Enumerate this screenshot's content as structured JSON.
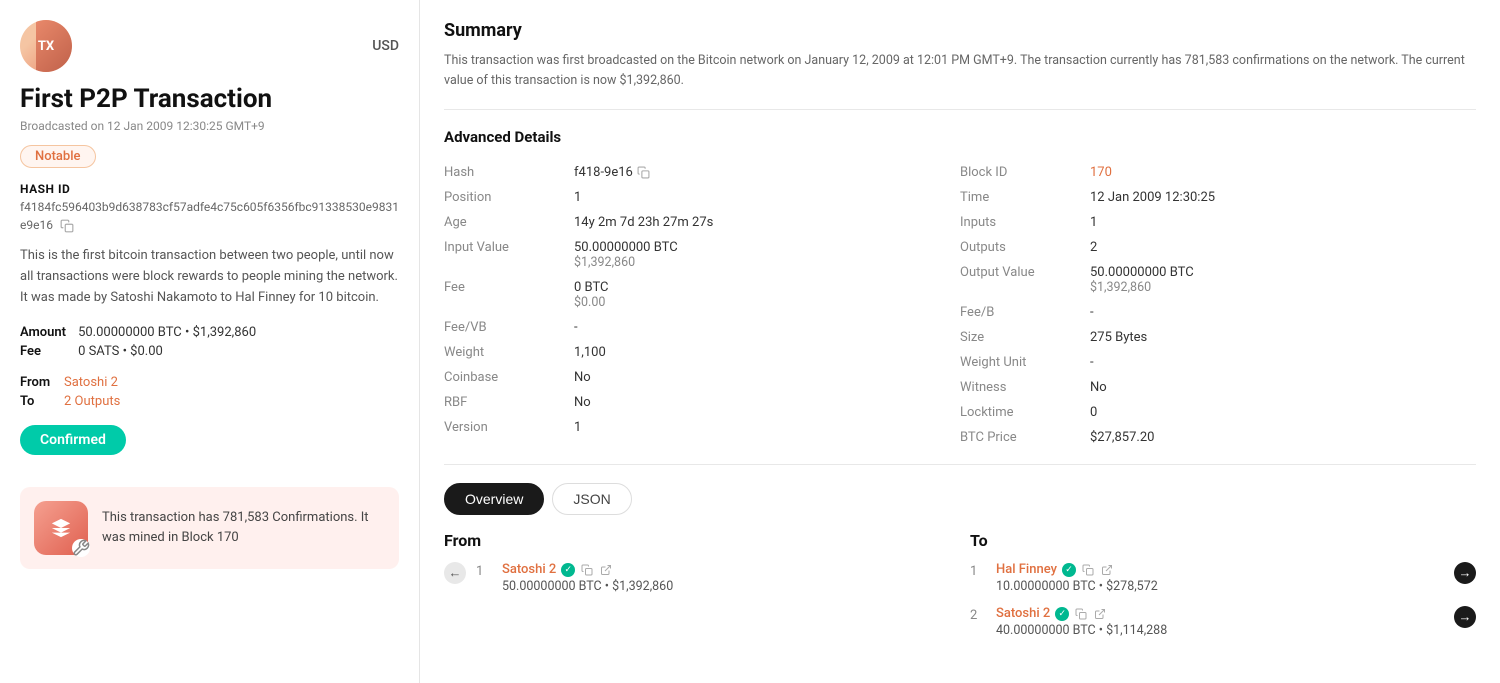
{
  "left": {
    "tx_label": "TX",
    "currency": "USD",
    "title": "First P2P Transaction",
    "broadcast": "Broadcasted on 12 Jan 2009 12:30:25 GMT+9",
    "notable": "Notable",
    "hash_label": "Hash ID",
    "hash_value": "f4184fc596403b9d638783cf57adfe4c75c605f6356fbc91338530e9831e9e16",
    "description": "This is the first bitcoin transaction between two people, until now all transactions were block rewards to people mining the network. It was made by Satoshi Nakamoto to Hal Finney for 10 bitcoin.",
    "amount_label": "Amount",
    "amount_value": "50.00000000 BTC • $1,392,860",
    "fee_label": "Fee",
    "fee_value": "0 SATS • $0.00",
    "from_label": "From",
    "from_value": "Satoshi 2",
    "to_label": "To",
    "to_value": "2 Outputs",
    "confirmed_label": "Confirmed",
    "confirmation_text": "This transaction has 781,583 Confirmations. It was mined in Block 170"
  },
  "right": {
    "summary_title": "Summary",
    "summary_text": "This transaction was first broadcasted on the Bitcoin network on January 12, 2009 at 12:01 PM GMT+9. The transaction currently has 781,583 confirmations on the network. The current value of this transaction is now $1,392,860.",
    "advanced_title": "Advanced Details",
    "details_left": [
      {
        "key": "Hash",
        "value": "f418-9e16",
        "type": "copy"
      },
      {
        "key": "Position",
        "value": "1",
        "type": "plain"
      },
      {
        "key": "Age",
        "value": "14y 2m 7d 23h 27m 27s",
        "type": "plain"
      },
      {
        "key": "Input Value",
        "value": "50.00000000 BTC",
        "sub": "$1,392,860",
        "type": "multi"
      },
      {
        "key": "Fee",
        "value": "0 BTC",
        "sub": "$0.00",
        "type": "multi"
      },
      {
        "key": "Fee/VB",
        "value": "-",
        "type": "plain"
      },
      {
        "key": "Weight",
        "value": "1,100",
        "type": "plain"
      },
      {
        "key": "Coinbase",
        "value": "No",
        "type": "plain"
      },
      {
        "key": "RBF",
        "value": "No",
        "type": "plain"
      },
      {
        "key": "Version",
        "value": "1",
        "type": "plain"
      }
    ],
    "details_right": [
      {
        "key": "Block ID",
        "value": "170",
        "type": "link"
      },
      {
        "key": "Time",
        "value": "12 Jan 2009 12:30:25",
        "type": "plain"
      },
      {
        "key": "Inputs",
        "value": "1",
        "type": "plain"
      },
      {
        "key": "Outputs",
        "value": "2",
        "type": "plain"
      },
      {
        "key": "Output Value",
        "value": "50.00000000 BTC",
        "sub": "$1,392,860",
        "type": "multi"
      },
      {
        "key": "Fee/B",
        "value": "-",
        "type": "plain"
      },
      {
        "key": "Size",
        "value": "275 Bytes",
        "type": "plain"
      },
      {
        "key": "Weight Unit",
        "value": "-",
        "type": "plain"
      },
      {
        "key": "Witness",
        "value": "No",
        "type": "plain"
      },
      {
        "key": "Locktime",
        "value": "0",
        "type": "plain"
      },
      {
        "key": "BTC Price",
        "value": "$27,857.20",
        "type": "plain"
      }
    ],
    "tabs": [
      {
        "label": "Overview",
        "active": true
      },
      {
        "label": "JSON",
        "active": false
      }
    ],
    "from_title": "From",
    "to_title": "To",
    "from_items": [
      {
        "num": "1",
        "name": "Satoshi 2",
        "amount": "50.00000000 BTC • $1,392,860",
        "verified": true
      }
    ],
    "to_items": [
      {
        "num": "1",
        "name": "Hal Finney",
        "amount": "10.00000000 BTC • $278,572",
        "verified": true
      },
      {
        "num": "2",
        "name": "Satoshi 2",
        "amount": "40.00000000 BTC • $1,114,288",
        "verified": true
      }
    ]
  }
}
